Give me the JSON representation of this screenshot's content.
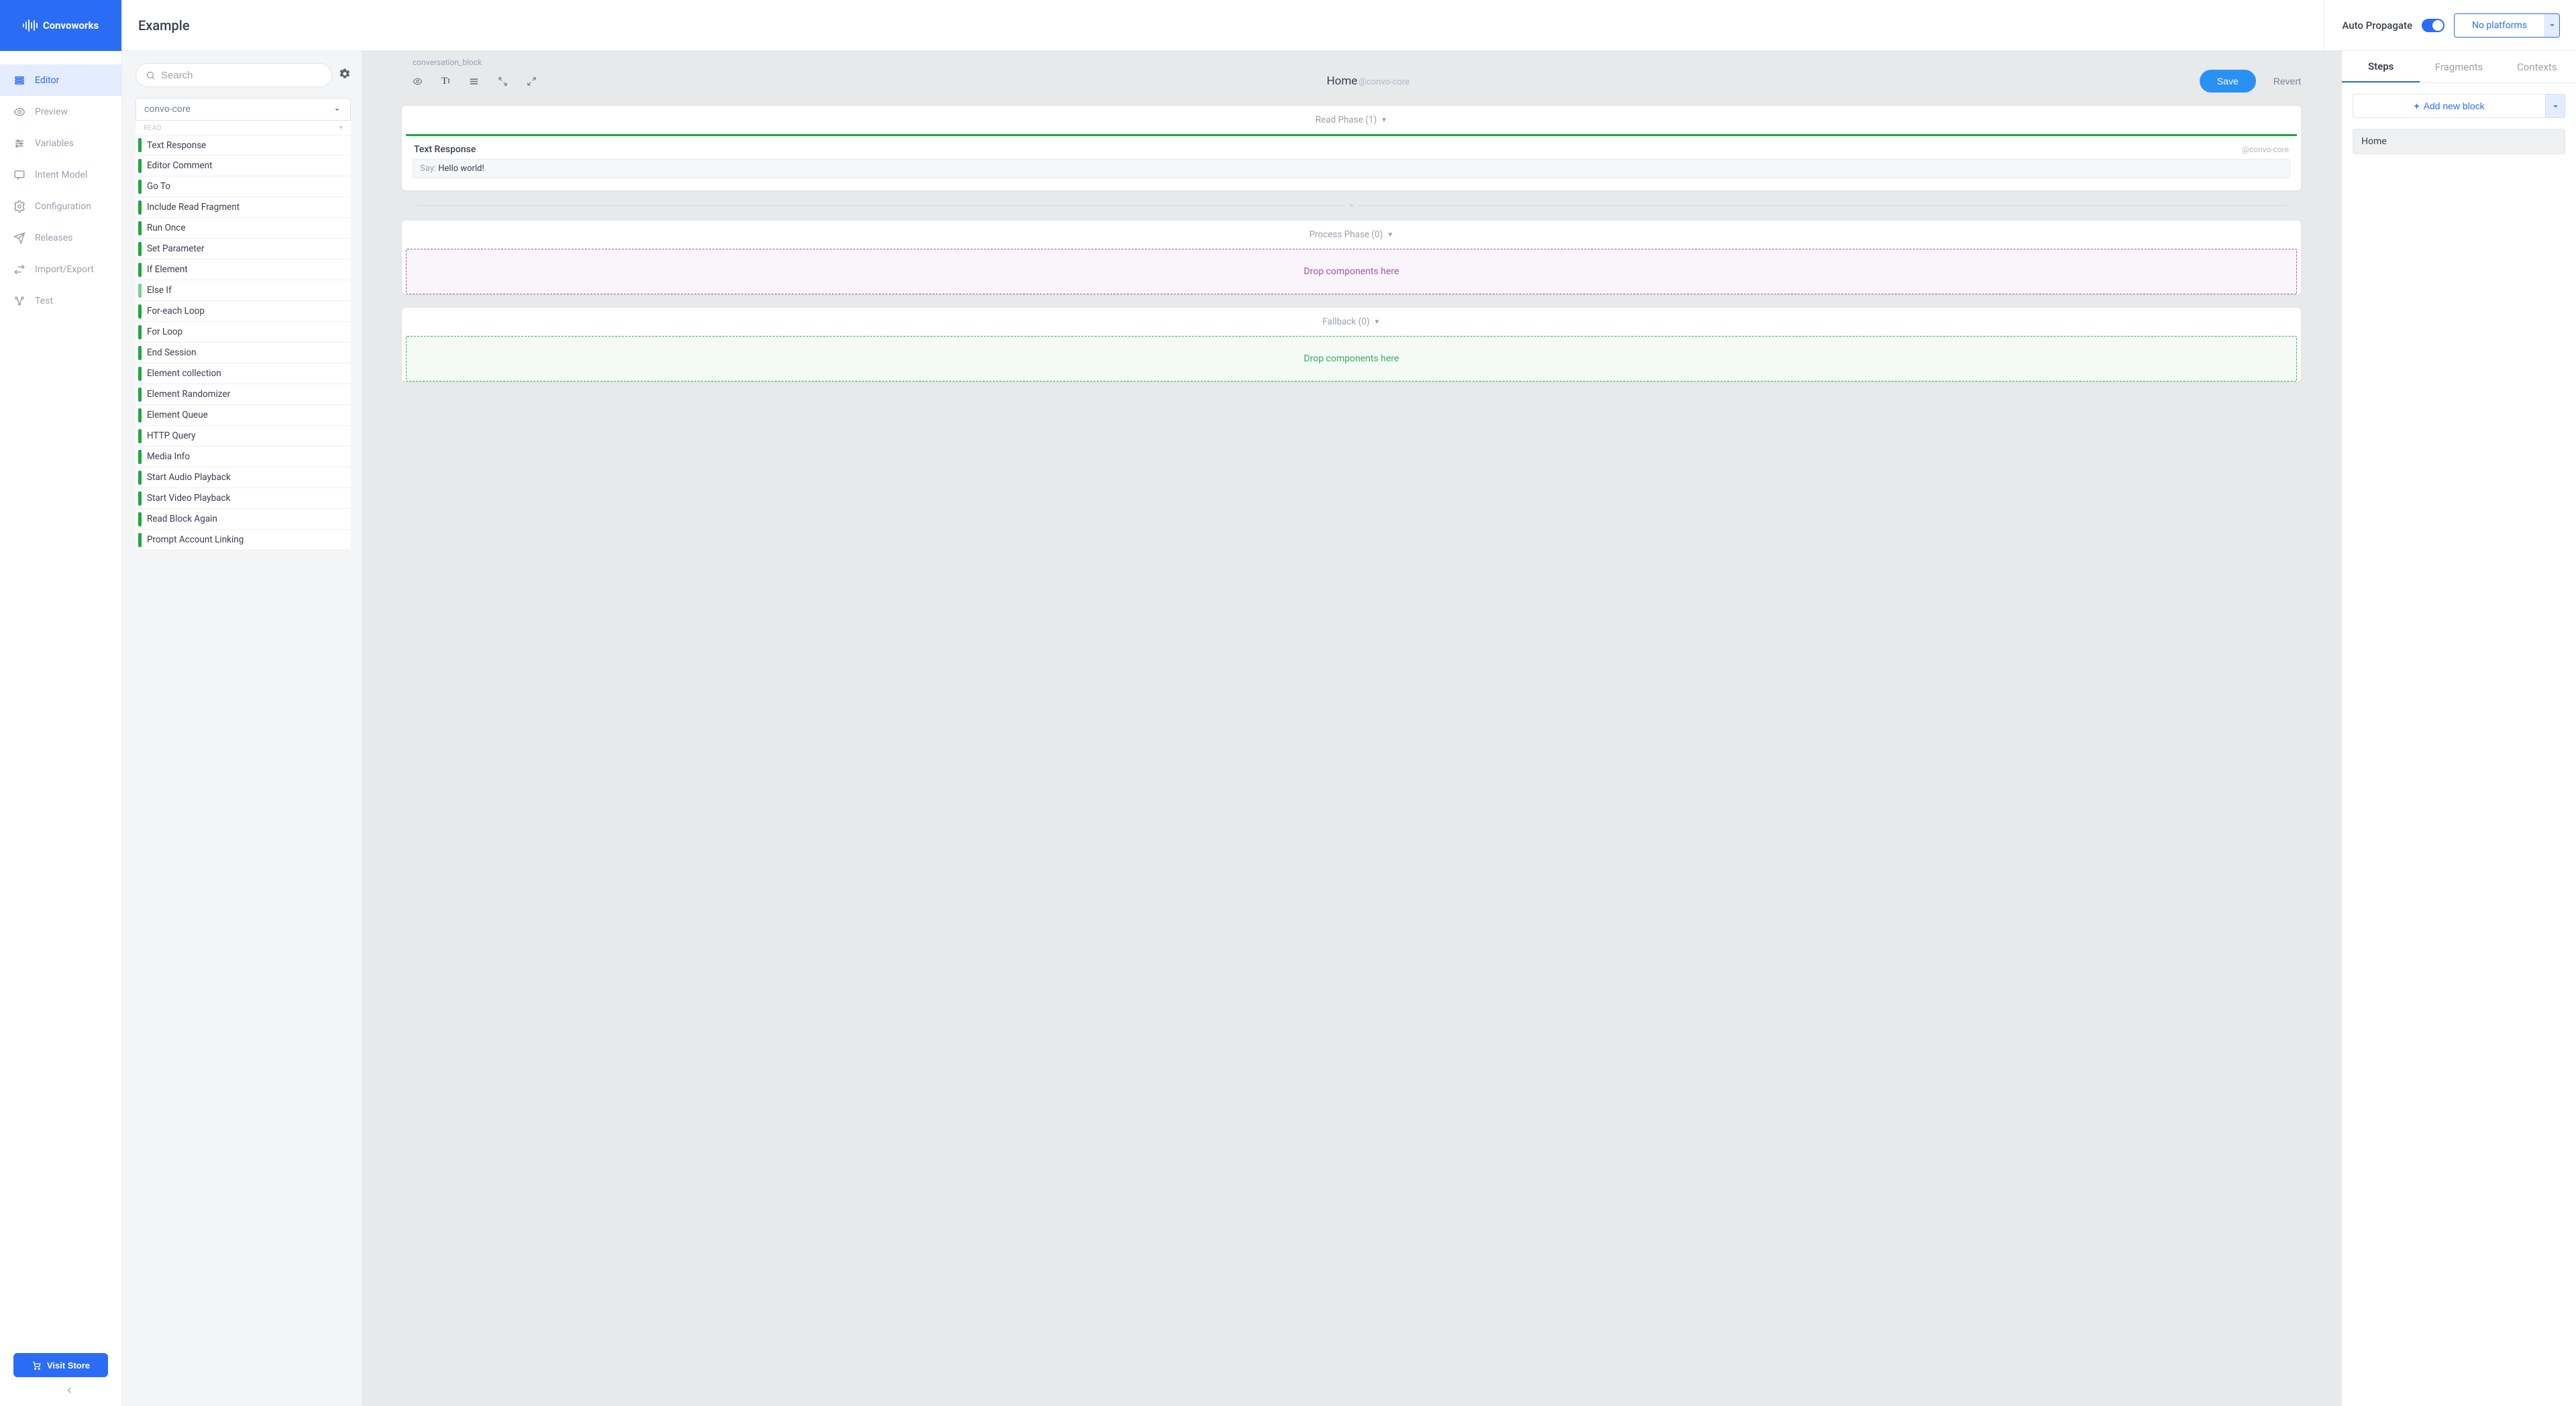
{
  "brand": "Convoworks",
  "project_title": "Example",
  "auto_propagate_label": "Auto Propagate",
  "platforms_button": "No platforms",
  "nav": [
    {
      "label": "Editor",
      "icon": "stack"
    },
    {
      "label": "Preview",
      "icon": "eye"
    },
    {
      "label": "Variables",
      "icon": "sliders"
    },
    {
      "label": "Intent Model",
      "icon": "chat"
    },
    {
      "label": "Configuration",
      "icon": "gear"
    },
    {
      "label": "Releases",
      "icon": "send"
    },
    {
      "label": "Import/Export",
      "icon": "transfer"
    },
    {
      "label": "Test",
      "icon": "graph"
    }
  ],
  "visit_store": "Visit Store",
  "search_placeholder": "Search",
  "package_selected": "convo-core",
  "component_group_label": "READ",
  "components": [
    {
      "label": "Text Response",
      "tone": "green"
    },
    {
      "label": "Editor Comment",
      "tone": "green"
    },
    {
      "label": "Go To",
      "tone": "green"
    },
    {
      "label": "Include Read Fragment",
      "tone": "green"
    },
    {
      "label": "Run Once",
      "tone": "green"
    },
    {
      "label": "Set Parameter",
      "tone": "green"
    },
    {
      "label": "If Element",
      "tone": "green"
    },
    {
      "label": "Else If",
      "tone": "lgreen"
    },
    {
      "label": "For-each Loop",
      "tone": "green"
    },
    {
      "label": "For Loop",
      "tone": "green"
    },
    {
      "label": "End Session",
      "tone": "green"
    },
    {
      "label": "Element collection",
      "tone": "green"
    },
    {
      "label": "Element Randomizer",
      "tone": "green"
    },
    {
      "label": "Element Queue",
      "tone": "green"
    },
    {
      "label": "HTTP Query",
      "tone": "green"
    },
    {
      "label": "Media Info",
      "tone": "green"
    },
    {
      "label": "Start Audio Playback",
      "tone": "green"
    },
    {
      "label": "Start Video Playback",
      "tone": "green"
    },
    {
      "label": "Read Block Again",
      "tone": "green"
    },
    {
      "label": "Prompt Account Linking",
      "tone": "green"
    }
  ],
  "canvas": {
    "block_type": "conversation_block",
    "block_title": "Home",
    "block_pkg": "@convo-core",
    "save": "Save",
    "revert": "Revert",
    "read_phase_title": "Read Phase (1)",
    "text_response": {
      "title": "Text Response",
      "pkg": "@convo-core",
      "say_label": "Say:",
      "say_value": "Hello world!"
    },
    "process_phase_title": "Process Phase (0)",
    "process_dropzone": "Drop components here",
    "fallback_phase_title": "Fallback (0)",
    "fallback_dropzone": "Drop components here"
  },
  "inspector": {
    "tabs": [
      "Steps",
      "Fragments",
      "Contexts"
    ],
    "add_block": "Add new block",
    "steps": [
      "Home"
    ]
  }
}
